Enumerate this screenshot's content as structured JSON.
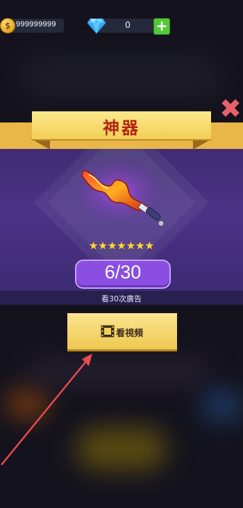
{
  "currency": {
    "coins": "999999999",
    "gems": "0",
    "coin_symbol": "$"
  },
  "dialog": {
    "title": "神器",
    "stars_count": 7,
    "stars_text": "★★★★★★★",
    "progress": "6/30",
    "progress_value": {
      "current": 6,
      "total": 30
    },
    "info_text": "看30次廣告",
    "watch_button_label": "看視頻",
    "close_symbol": "✖"
  },
  "colors": {
    "panel_purple": "#4b3386",
    "banner_gold": "#f2cf55",
    "title_red": "#b02512",
    "progress_purple": "#8a4fe0",
    "close_red": "#e8606a",
    "plus_green": "#55c83a"
  },
  "icons": {
    "coin": "coin-icon",
    "gem": "diamond-gem-icon",
    "plus": "plus-icon",
    "close": "close-icon",
    "film": "film-video-icon",
    "weapon": "flaming-dagger-icon",
    "arrow": "pointer-arrow-icon"
  }
}
